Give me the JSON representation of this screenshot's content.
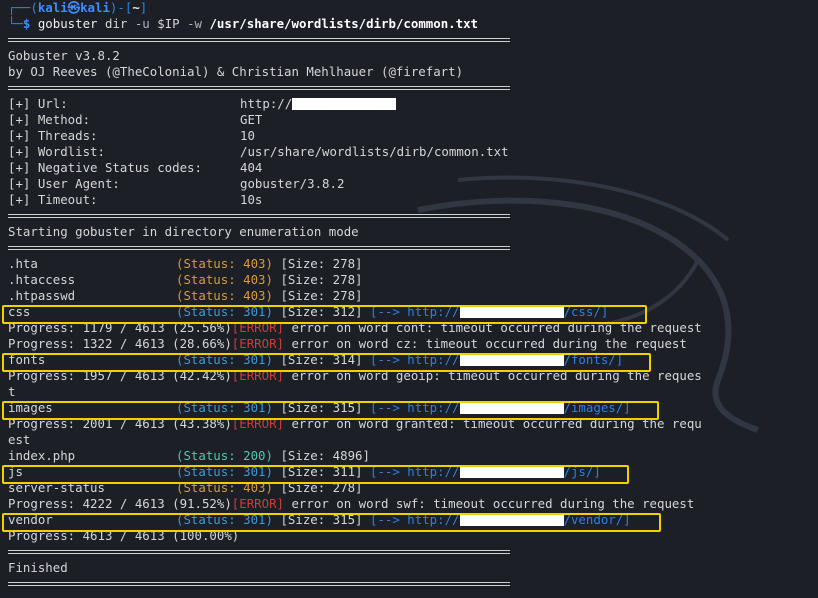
{
  "prompt": {
    "corner_top": "┌──(",
    "user": "kali㉿kali",
    "mid": ")-[",
    "cwd": "~",
    "close": "]",
    "corner_bottom": "└─",
    "dollar": "$ ",
    "cmd": "gobuster",
    "cmd_rest_1": " dir ",
    "flag_u": "-u",
    "var_ip": " $IP ",
    "flag_w": "-w",
    "wordlist": " /usr/share/wordlists/dirb/common.txt"
  },
  "banner": {
    "version": "Gobuster v3.8.2",
    "authors": "by OJ Reeves (@TheColonial) & Christian Mehlhauer (@firefart)"
  },
  "config": [
    {
      "key": "[+] Url:",
      "value": "http://",
      "masked": true
    },
    {
      "key": "[+] Method:",
      "value": "GET"
    },
    {
      "key": "[+] Threads:",
      "value": "10"
    },
    {
      "key": "[+] Wordlist:",
      "value": "/usr/share/wordlists/dirb/common.txt"
    },
    {
      "key": "[+] Negative Status codes:",
      "value": "404"
    },
    {
      "key": "[+] User Agent:",
      "value": "gobuster/3.8.2"
    },
    {
      "key": "[+] Timeout:",
      "value": "10s"
    }
  ],
  "start_msg": "Starting gobuster in directory enumeration mode",
  "results": {
    "hta": {
      "path": ".hta",
      "status": "(Status: 403)",
      "size": "[Size: 278]"
    },
    "htaccess": {
      "path": ".htaccess",
      "status": "(Status: 403)",
      "size": "[Size: 278]"
    },
    "htpasswd": {
      "path": ".htpasswd",
      "status": "(Status: 403)",
      "size": "[Size: 278]"
    },
    "css": {
      "path": "css",
      "status": "(Status: 301)",
      "size": "[Size: 312]",
      "redir_pre": "[--> http://",
      "redir_post": "/css/]"
    },
    "fonts": {
      "path": "fonts",
      "status": "(Status: 301)",
      "size": "[Size: 314]",
      "redir_pre": "[--> http://",
      "redir_post": "/fonts/]"
    },
    "images": {
      "path": "images",
      "status": "(Status: 301)",
      "size": "[Size: 315]",
      "redir_pre": "[--> http://",
      "redir_post": "/images/]"
    },
    "index": {
      "path": "index.php",
      "status": "(Status: 200)",
      "size": "[Size: 4896]"
    },
    "js": {
      "path": "js",
      "status": "(Status: 301)",
      "size": "[Size: 311]",
      "redir_pre": "[--> http://",
      "redir_post": "/js/]"
    },
    "server_status": {
      "path": "server-status",
      "status": "(Status: 403)",
      "size": "[Size: 278]"
    },
    "vendor": {
      "path": "vendor",
      "status": "(Status: 301)",
      "size": "[Size: 315]",
      "redir_pre": "[--> http://",
      "redir_post": "/vendor/]"
    }
  },
  "progress": {
    "p1": {
      "pre": "Progress: 1179 / 4613 (25.56%)",
      "tag": "[ERROR]",
      "msg": " error on word cont: timeout occurred during the request"
    },
    "p2": {
      "pre": "Progress: 1322 / 4613 (28.66%)",
      "tag": "[ERROR]",
      "msg": " error on word cz: timeout occurred during the request"
    },
    "p3": {
      "pre": "Progress: 1957 / 4613 (42.42%)",
      "tag": "[ERROR]",
      "msg": " error on word geoip: timeout occurred during the reques",
      "wrap": "t"
    },
    "p4": {
      "pre": "Progress: 2001 / 4613 (43.38%)",
      "tag": "[ERROR]",
      "msg": " error on word granted: timeout occurred during the requ",
      "wrap": "est"
    },
    "p5": {
      "pre": "Progress: 4222 / 4613 (91.52%)",
      "tag": "[ERROR]",
      "msg": " error on word swf: timeout occurred during the request"
    },
    "final": "Progress: 4613 / 4613 (100.00%)"
  },
  "finished": "Finished",
  "colors": {
    "background": "#1c1f26",
    "highlight": "#f0d000",
    "status_403": "#d89b3a",
    "status_301": "#3c9ad6",
    "error": "#d23b3b"
  }
}
